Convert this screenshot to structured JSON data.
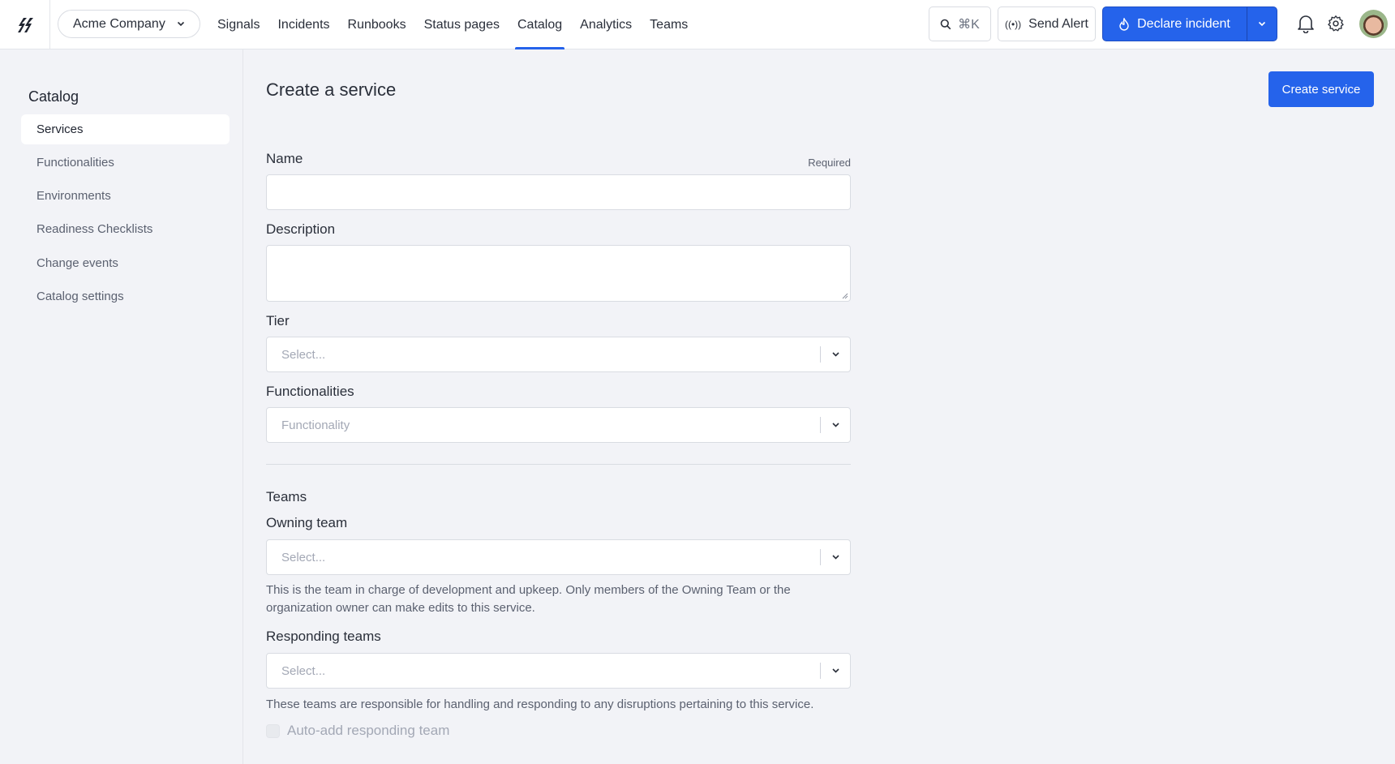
{
  "header": {
    "company": "Acme Company",
    "nav": [
      {
        "label": "Signals",
        "active": false
      },
      {
        "label": "Incidents",
        "active": false
      },
      {
        "label": "Runbooks",
        "active": false
      },
      {
        "label": "Status pages",
        "active": false
      },
      {
        "label": "Catalog",
        "active": true
      },
      {
        "label": "Analytics",
        "active": false
      },
      {
        "label": "Teams",
        "active": false
      }
    ],
    "search_shortcut": "⌘K",
    "send_alert_label": "Send Alert",
    "declare_label": "Declare incident",
    "accent_color": "#2563eb"
  },
  "sidebar": {
    "title": "Catalog",
    "items": [
      {
        "label": "Services",
        "active": true
      },
      {
        "label": "Functionalities",
        "active": false
      },
      {
        "label": "Environments",
        "active": false
      },
      {
        "label": "Readiness Checklists",
        "active": false
      },
      {
        "label": "Change events",
        "active": false
      },
      {
        "label": "Catalog settings",
        "active": false
      }
    ]
  },
  "main": {
    "title": "Create a service",
    "create_button": "Create service",
    "form": {
      "name": {
        "label": "Name",
        "required_label": "Required",
        "value": ""
      },
      "description": {
        "label": "Description",
        "value": ""
      },
      "tier": {
        "label": "Tier",
        "placeholder": "Select..."
      },
      "functionalities": {
        "label": "Functionalities",
        "placeholder": "Functionality"
      },
      "teams_section": "Teams",
      "owning_team": {
        "label": "Owning team",
        "placeholder": "Select...",
        "help": "This is the team in charge of development and upkeep. Only members of the Owning Team or the organization owner can make edits to this service."
      },
      "responding_teams": {
        "label": "Responding teams",
        "placeholder": "Select...",
        "help": "These teams are responsible for handling and responding to any disruptions pertaining to this service."
      },
      "auto_add": {
        "label": "Auto-add responding team",
        "checked": false,
        "disabled": true
      }
    }
  }
}
